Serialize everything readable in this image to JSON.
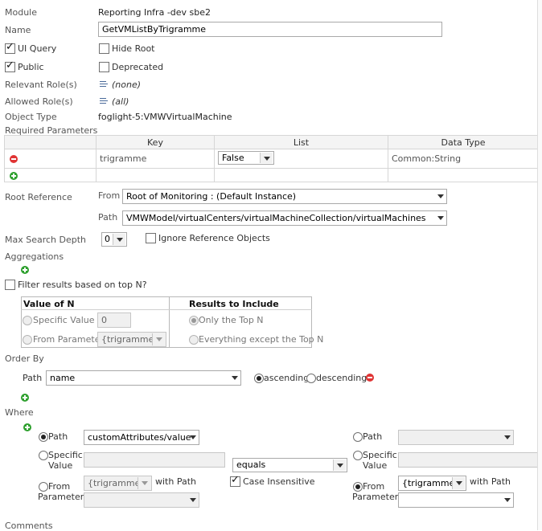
{
  "fields": {
    "module_label": "Module",
    "module_value": "Reporting Infra -dev sbe2",
    "name_label": "Name",
    "name_value": "GetVMListByTrigramme",
    "ui_query": "UI Query",
    "hide_root": "Hide Root",
    "public": "Public",
    "deprecated": "Deprecated",
    "relevant_roles_label": "Relevant Role(s)",
    "relevant_roles_value": "(none)",
    "allowed_roles_label": "Allowed Role(s)",
    "allowed_roles_value": "(all)",
    "object_type_label": "Object Type",
    "object_type_value": "foglight-5:VMWVirtualMachine"
  },
  "params": {
    "title": "Required Parameters",
    "headers": [
      "Key",
      "List",
      "Data Type"
    ],
    "row": {
      "key": "trigramme",
      "list": "False",
      "type": "Common:String"
    }
  },
  "root": {
    "label": "Root Reference",
    "from_label": "From",
    "from_value": "Root of Monitoring : (Default Instance)",
    "path_label": "Path",
    "path_value": "VMWModel/virtualCenters/virtualMachineCollection/virtualMachines"
  },
  "search": {
    "label": "Max Search Depth",
    "depth": "0",
    "ignore": "Ignore Reference Objects"
  },
  "aggregations": {
    "label": "Aggregations"
  },
  "topn": {
    "filter_label": "Filter results based on top N?",
    "value_header": "Value of N",
    "specific": "Specific Value",
    "specific_value": "0",
    "from_param": "From Parameter",
    "from_param_value": "{trigramme}",
    "results_header": "Results to Include",
    "only_top": "Only the Top N",
    "except_top": "Everything except the Top N"
  },
  "orderby": {
    "label": "Order By",
    "path_label": "Path",
    "path_value": "name",
    "asc": "ascending",
    "desc": "descending"
  },
  "where": {
    "label": "Where",
    "path": "Path",
    "path_value": "customAttributes/value",
    "specific": "Specific Value",
    "from_param": "From Parameter",
    "param_value": "{trigramme}",
    "with_path": "with Path",
    "operator": "equals",
    "case_insensitive": "Case Insensitive"
  },
  "comments": {
    "label": "Comments"
  },
  "colors": {
    "remove": "#e03434",
    "add": "#2ea02e"
  }
}
